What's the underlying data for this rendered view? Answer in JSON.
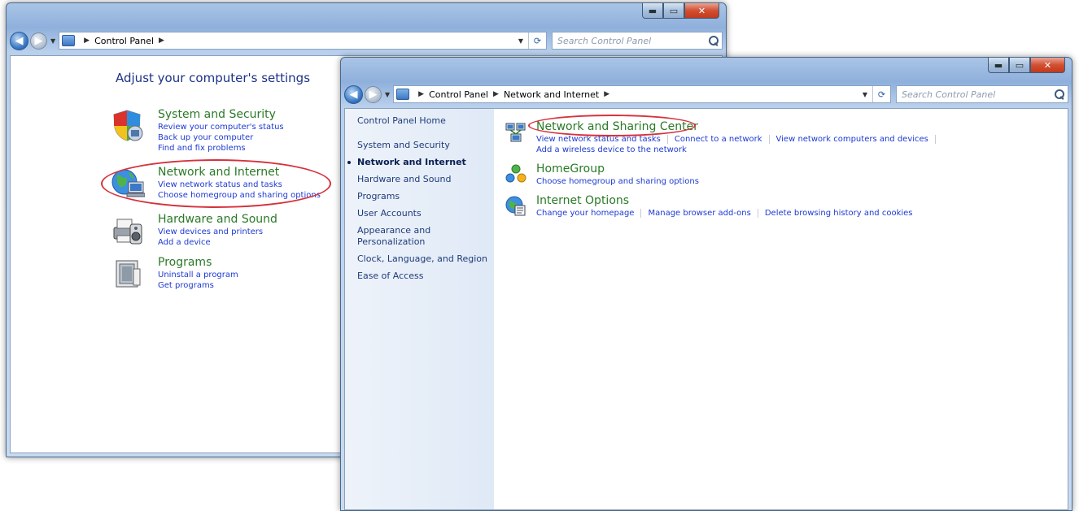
{
  "back_window": {
    "address": {
      "crumbs": [
        "Control Panel"
      ]
    },
    "search": {
      "placeholder": "Search Control Panel"
    },
    "heading": "Adjust your computer's settings",
    "categories": [
      {
        "title": "System and Security",
        "links": [
          "Review your computer's status",
          "Back up your computer",
          "Find and fix problems"
        ]
      },
      {
        "title": "Network and Internet",
        "links": [
          "View network status and tasks",
          "Choose homegroup and sharing options"
        ]
      },
      {
        "title": "Hardware and Sound",
        "links": [
          "View devices and printers",
          "Add a device"
        ]
      },
      {
        "title": "Programs",
        "links": [
          "Uninstall a program",
          "Get programs"
        ]
      }
    ]
  },
  "front_window": {
    "address": {
      "crumbs": [
        "Control Panel",
        "Network and Internet"
      ]
    },
    "search": {
      "placeholder": "Search Control Panel"
    },
    "sidebar": {
      "home": "Control Panel Home",
      "items": [
        "System and Security",
        "Network and Internet",
        "Hardware and Sound",
        "Programs",
        "User Accounts",
        "Appearance and Personalization",
        "Clock, Language, and Region",
        "Ease of Access"
      ],
      "current": "Network and Internet"
    },
    "categories": [
      {
        "title": "Network and Sharing Center",
        "links": [
          "View network status and tasks",
          "Connect to a network",
          "View network computers and devices",
          "Add a wireless device to the network"
        ]
      },
      {
        "title": "HomeGroup",
        "links": [
          "Choose homegroup and sharing options"
        ]
      },
      {
        "title": "Internet Options",
        "links": [
          "Change your homepage",
          "Manage browser add-ons",
          "Delete browsing history and cookies"
        ]
      }
    ]
  },
  "colors": {
    "accent_green": "#2a7a27",
    "link_blue": "#1d3ad1",
    "highlight_red": "#d6323c"
  },
  "icons": {
    "back": "back-arrow-icon",
    "forward": "forward-arrow-icon",
    "search": "search-icon",
    "refresh": "refresh-icon",
    "minimize": "minimize-icon",
    "maximize": "maximize-icon",
    "close": "close-icon"
  }
}
